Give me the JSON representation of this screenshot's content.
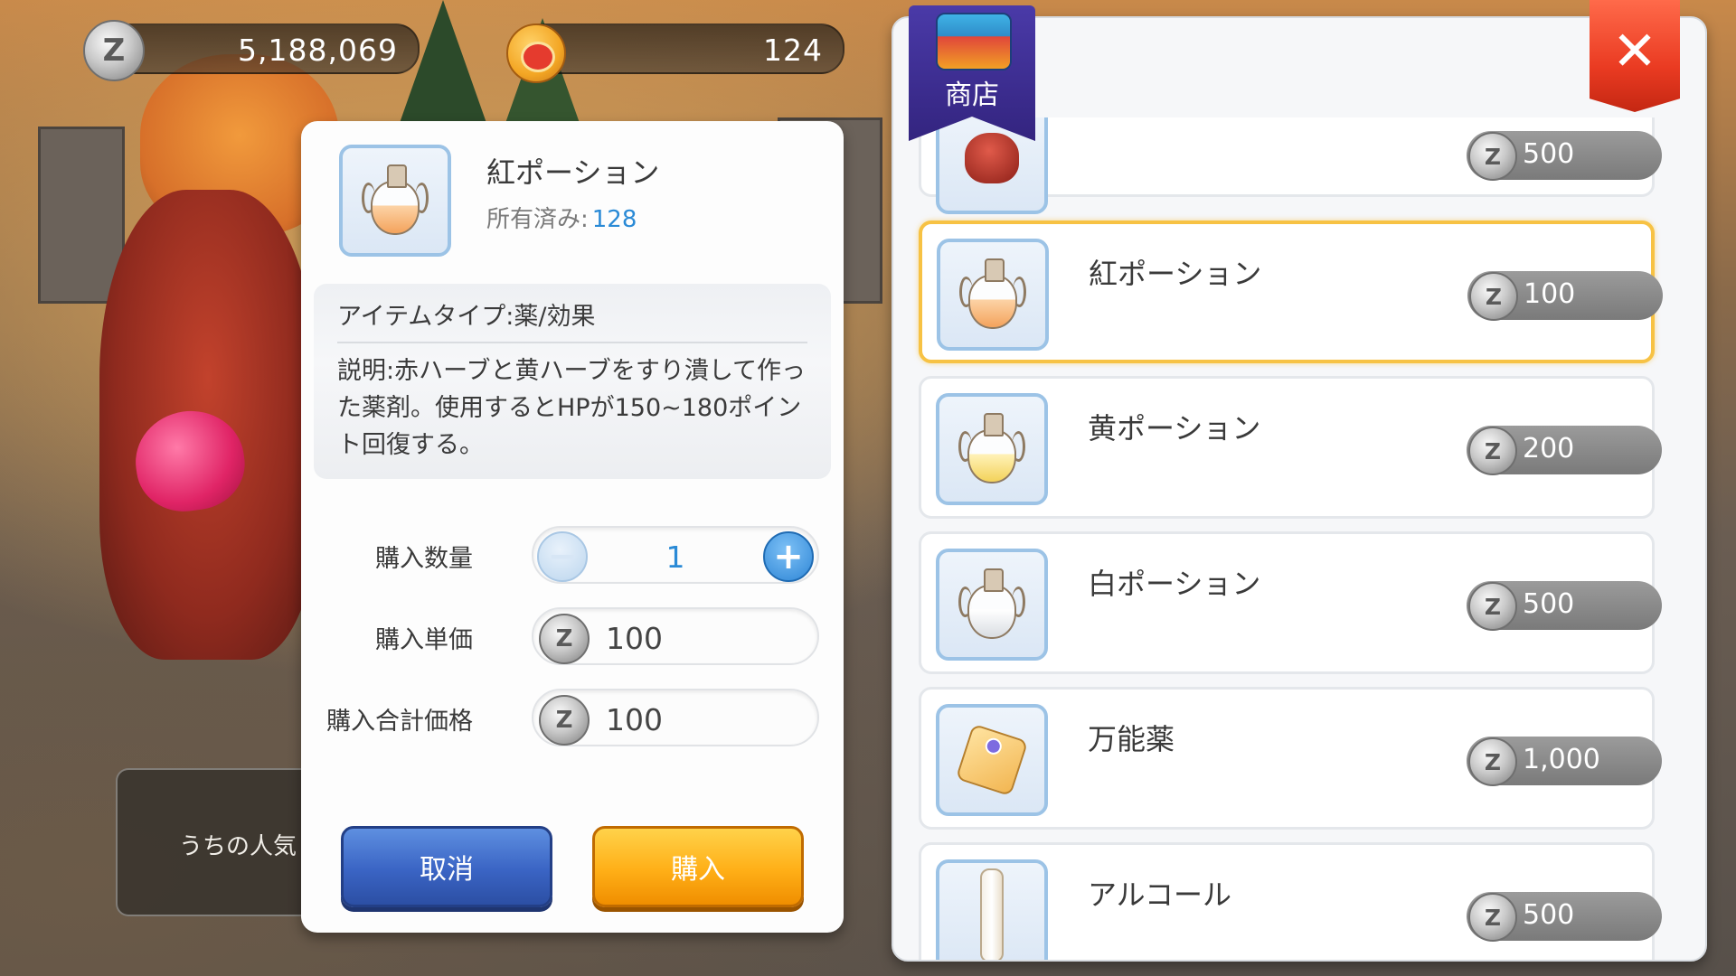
{
  "currency": {
    "zeny": "5,188,069",
    "zeny_coin_letter": "Z",
    "cat_coins": "124"
  },
  "bubble_text": "うちの人気",
  "detail": {
    "item_name": "紅ポーション",
    "owned_label": "所有済み:",
    "owned_count": "128",
    "item_type": "アイテムタイプ:薬/効果",
    "description": "説明:赤ハーブと黄ハーブをすり潰して作った薬剤。使用するとHPが150~180ポイント回復する。",
    "quantity_label": "購入数量",
    "quantity": "1",
    "unit_price_label": "購入単価",
    "unit_price": "100",
    "total_label": "購入合計価格",
    "total_price": "100",
    "minus": "−",
    "plus": "+",
    "cancel_label": "取消",
    "buy_label": "購入"
  },
  "shop": {
    "title": "商店",
    "close_symbol": "✕",
    "partial_top_price": "500",
    "items": [
      {
        "name": "紅ポーション",
        "price": "100",
        "selected": true,
        "icon": "red-potion-icon"
      },
      {
        "name": "黄ポーション",
        "price": "200",
        "selected": false,
        "icon": "yellow-potion-icon"
      },
      {
        "name": "白ポーション",
        "price": "500",
        "selected": false,
        "icon": "white-potion-icon"
      },
      {
        "name": "万能薬",
        "price": "1,000",
        "selected": false,
        "icon": "panacea-icon"
      },
      {
        "name": "アルコール",
        "price": "500",
        "selected": false,
        "icon": "alcohol-icon"
      }
    ]
  },
  "colors": {
    "accent_blue": "#2a8ad6",
    "selected_border": "#f7c244",
    "buy_orange": "#ffaf17",
    "cancel_blue": "#3a64c4",
    "close_red": "#ea3b22"
  }
}
